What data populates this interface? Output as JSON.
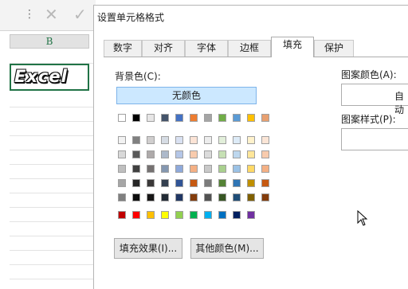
{
  "excel": {
    "formula_bar": {
      "icons": [
        "more-options-icon",
        "cancel-icon",
        "confirm-icon"
      ],
      "cancel_glyph": "✕",
      "confirm_glyph": "✓",
      "more_glyph": "⋮"
    },
    "column_header": "B",
    "cell_text": "Excel"
  },
  "dialog": {
    "title": "设置单元格格式",
    "tabs": [
      {
        "label": "数字"
      },
      {
        "label": "对齐"
      },
      {
        "label": "字体"
      },
      {
        "label": "边框"
      },
      {
        "label": "填充"
      },
      {
        "label": "保护"
      }
    ],
    "active_tab": "填充",
    "background_color_label": "背景色(C):",
    "no_color_label": "无颜色",
    "pattern_color_label": "图案颜色(A):",
    "pattern_color_value": "自动",
    "pattern_style_label": "图案样式(P):",
    "fill_effects_label": "填充效果(I)...",
    "more_colors_label": "其他颜色(M)..."
  },
  "palette": {
    "theme_top": [
      "#ffffff",
      "#000000",
      "#e7e6e6",
      "#44546a",
      "#4472c4",
      "#ed7d31",
      "#a5a5a5",
      "#70ad47",
      "#5b9bd5",
      "#ffc000",
      "#e8a070"
    ],
    "theme_rows": [
      [
        "#f2f2f2",
        "#808080",
        "#d0cece",
        "#d6dce4",
        "#d9e1f2",
        "#fce4d6",
        "#ededed",
        "#e2efda",
        "#ddebf7",
        "#fff2cc",
        "#fbe5d6"
      ],
      [
        "#d9d9d9",
        "#595959",
        "#aeaaaa",
        "#adb9ca",
        "#b4c6e7",
        "#f8cbad",
        "#dbdbdb",
        "#c6e0b4",
        "#bdd7ee",
        "#ffe699",
        "#f8cbad"
      ],
      [
        "#bfbfbf",
        "#404040",
        "#757171",
        "#8497b0",
        "#8ea9db",
        "#f4b084",
        "#c9c9c9",
        "#a9d08e",
        "#9bc2e6",
        "#ffd966",
        "#f4b084"
      ],
      [
        "#a6a6a6",
        "#262626",
        "#3a3838",
        "#333f4f",
        "#305496",
        "#c65911",
        "#7b7b7b",
        "#548235",
        "#2f75b5",
        "#bf8f00",
        "#c65911"
      ],
      [
        "#808080",
        "#0d0d0d",
        "#171616",
        "#222b35",
        "#203764",
        "#833c0c",
        "#525252",
        "#375623",
        "#1f4e78",
        "#806000",
        "#833c0c"
      ]
    ],
    "standard": [
      "#c00000",
      "#ff0000",
      "#ffc000",
      "#ffff00",
      "#92d050",
      "#00b050",
      "#00b0f0",
      "#0070c0",
      "#002060",
      "#7030a0"
    ]
  }
}
